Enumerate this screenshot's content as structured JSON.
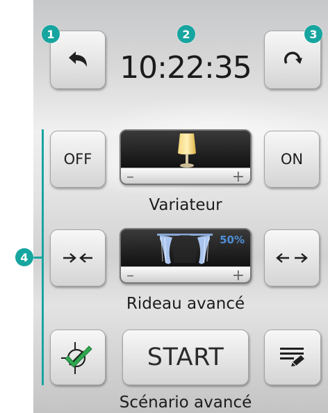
{
  "header": {
    "clock": "10:22:35",
    "back_icon": "undo-arrow-icon",
    "refresh_icon": "refresh-icon"
  },
  "callouts": [
    "1",
    "2",
    "3",
    "4"
  ],
  "dimmer": {
    "off_label": "OFF",
    "on_label": "ON",
    "label": "Variateur",
    "minus": "–",
    "plus": "+",
    "icon": "lamp-icon"
  },
  "curtain": {
    "label": "Rideau avancé",
    "percent": "50%",
    "level": 0.5,
    "close_icon": "close-curtain-arrows-icon",
    "open_icon": "open-curtain-arrows-icon",
    "minus": "–",
    "plus": "+",
    "icon": "curtain-icon"
  },
  "scenario": {
    "start_label": "START",
    "label": "Scénario avancé",
    "enable_icon": "scenario-enabled-check-icon",
    "edit_icon": "edit-list-icon"
  },
  "colors": {
    "accent": "#17a5a0",
    "percent_text": "#4f8fd8",
    "check_green": "#2fa84f"
  }
}
